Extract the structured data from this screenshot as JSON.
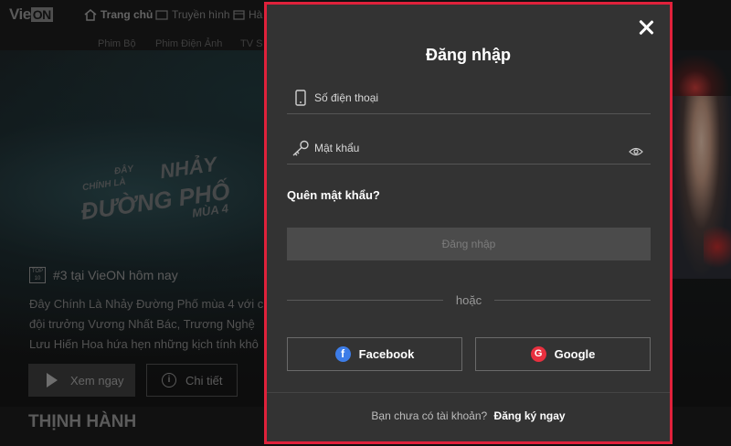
{
  "background": {
    "logo": {
      "text": "Vie",
      "on": "ON"
    },
    "nav": [
      {
        "label": "Trang chủ",
        "icon": "home-icon"
      },
      {
        "label": "Truyền hình",
        "icon": "tv-icon"
      },
      {
        "label": "Hà",
        "icon": "calendar-icon"
      }
    ],
    "subnav": [
      "Phim Bộ",
      "Phim Điện Ảnh",
      "TV S"
    ],
    "hero_logo": {
      "line1": "ĐÂY",
      "line2": "NHẢY",
      "line3": "ĐƯỜNG PHỐ",
      "line4": "MÙA 4",
      "line1b": "CHÍNH LÀ"
    },
    "rank": {
      "badge_top": "TOP",
      "badge_num": "10",
      "text": "#3 tại VieON hôm nay"
    },
    "description": [
      "Đây Chính Là Nhảy Đường Phố mùa 4 với c",
      "đội trưởng Vương Nhất Bác, Trương Nghệ",
      "Lưu Hiến Hoa hứa hẹn những kịch tính khô"
    ],
    "play_label": "Xem ngay",
    "detail_label": "Chi tiết",
    "trending": "THỊNH HÀNH"
  },
  "modal": {
    "title": "Đăng nhập",
    "phone_placeholder": "Số điện thoại",
    "password_placeholder": "Mật khẩu",
    "forgot": "Quên mật khẩu?",
    "login_label": "Đăng nhập",
    "or": "hoặc",
    "facebook_label": "Facebook",
    "google_label": "Google",
    "footer_text": "Bạn chưa có tài khoản?",
    "register_label": "Đăng ký ngay",
    "accent": "#e0213b"
  }
}
